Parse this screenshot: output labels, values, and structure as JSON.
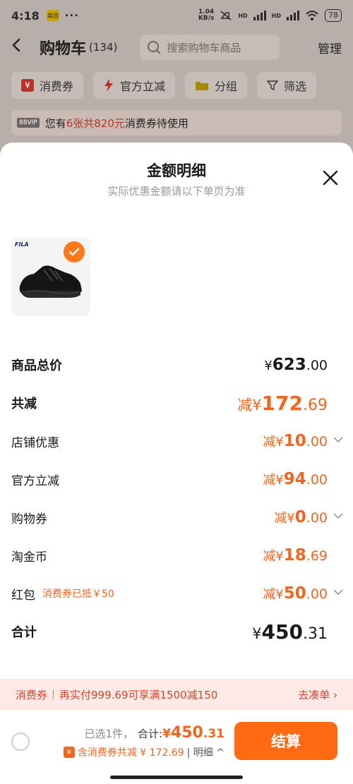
{
  "status_bar": {
    "time": "4:18",
    "app_badge": "美团",
    "dots": "···",
    "speed_value": "1.04",
    "speed_unit": "KB/s",
    "hd1": "HD",
    "hd2": "HD",
    "battery": "78"
  },
  "nav": {
    "title": "购物车",
    "count": "(134)",
    "search_placeholder": "搜索购物车商品",
    "manage": "管理"
  },
  "filters": [
    {
      "label": "消费券",
      "icon": "voucher-icon"
    },
    {
      "label": "官方立减",
      "icon": "lightning-icon"
    },
    {
      "label": "分组",
      "icon": "folder-icon"
    },
    {
      "label": "筛选",
      "icon": "filter-icon"
    }
  ],
  "banner": {
    "vip": "88VIP",
    "prefix": "您有",
    "highlight": "6张共820元",
    "suffix": "消费券待使用"
  },
  "sheet": {
    "title": "金额明细",
    "subtitle": "实际优惠金额请以下单页为准"
  },
  "product": {
    "brand": "FILA"
  },
  "rows": {
    "total_price": {
      "label": "商品总价",
      "pre": "¥",
      "int": "623",
      "dec": ".00"
    },
    "total_discount": {
      "label": "共减",
      "pre": "减¥",
      "int": "172",
      "dec": ".69"
    },
    "shop_discount": {
      "label": "店铺优惠",
      "pre": "减¥",
      "int": "10",
      "dec": ".00"
    },
    "official_discount": {
      "label": "官方立减",
      "pre": "减¥",
      "int": "94",
      "dec": ".00"
    },
    "shopping_voucher": {
      "label": "购物券",
      "pre": "减¥",
      "int": "0",
      "dec": ".00"
    },
    "tao_coins": {
      "label": "淘金币",
      "pre": "减¥",
      "int": "18",
      "dec": ".69"
    },
    "red_packet": {
      "label": "红包",
      "note": "消费券已抵￥50",
      "pre": "减¥",
      "int": "50",
      "dec": ".00"
    },
    "subtotal": {
      "label": "合计",
      "pre": "¥",
      "int": "450",
      "dec": ".31"
    }
  },
  "promo": {
    "tag": "消费券",
    "text": "再实付999.69可享满1500减150",
    "link": "去凑单 ›"
  },
  "footer": {
    "selected": "已选1件，",
    "total_label": "合计:",
    "pre": "¥",
    "int": "450",
    "dec": ".31",
    "coupon_text": "含消费券共减 ¥ 172.69",
    "detail": "| 明细 ^",
    "checkout": "结算"
  },
  "colors": {
    "accent": "#ff6a12",
    "discount": "#f0661f",
    "promo_bg": "#fde9e6"
  }
}
